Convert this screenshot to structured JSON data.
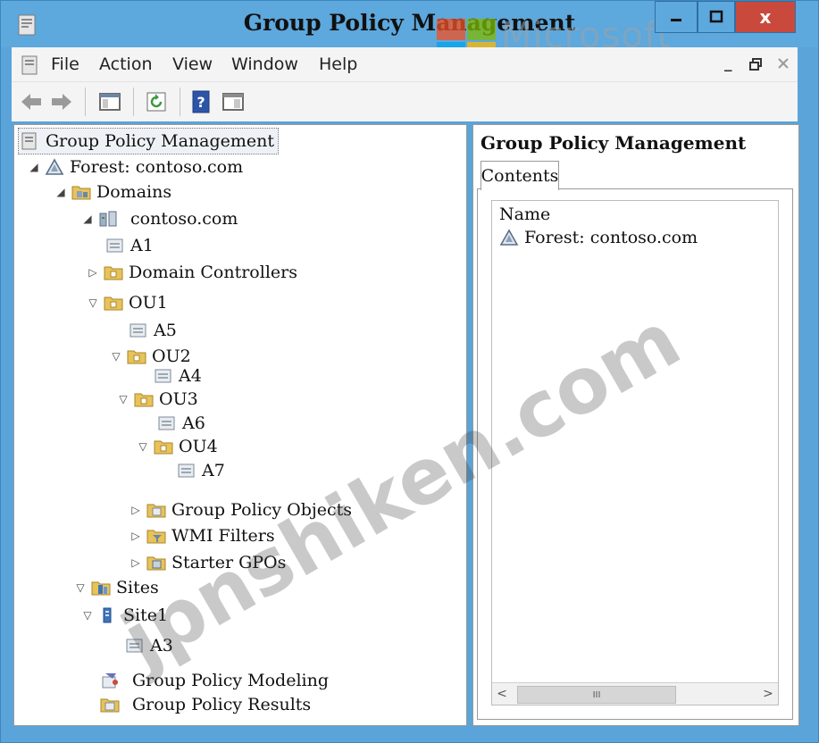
{
  "window": {
    "title": "Group Policy Management",
    "watermark": "Microsoft",
    "overlay_watermark": "jpnshiken.com",
    "controls": {
      "close_glyph": "x"
    }
  },
  "menu": {
    "items": [
      "File",
      "Action",
      "View",
      "Window",
      "Help"
    ]
  },
  "toolbar": {
    "icons": [
      "back-arrow-icon",
      "forward-arrow-icon",
      "show-hide-tree-icon",
      "refresh-icon",
      "help-icon",
      "console-icon"
    ]
  },
  "tree": {
    "root": "Group Policy Management",
    "forest": "Forest: contoso.com",
    "domains": "Domains",
    "domain": "contoso.com",
    "a1": "A1",
    "domain_controllers": "Domain Controllers",
    "ou1": "OU1",
    "a5": "A5",
    "ou2": "OU2",
    "a4": "A4",
    "ou3": "OU3",
    "a6": "A6",
    "ou4": "OU4",
    "a7": "A7",
    "gpo": "Group Policy Objects",
    "wmi": "WMI Filters",
    "starter": "Starter GPOs",
    "sites": "Sites",
    "site1": "Site1",
    "a3": "A3",
    "modeling": "Group Policy Modeling",
    "results": "Group Policy Results"
  },
  "right_pane": {
    "header": "Group Policy Management",
    "tab": "Contents",
    "column": "Name",
    "items": [
      "Forest: contoso.com"
    ],
    "scroll_thumb": "III"
  },
  "colors": {
    "title_bar": "#5da8dd",
    "close_button": "#c94a3c",
    "folder": "#e8c35a"
  }
}
